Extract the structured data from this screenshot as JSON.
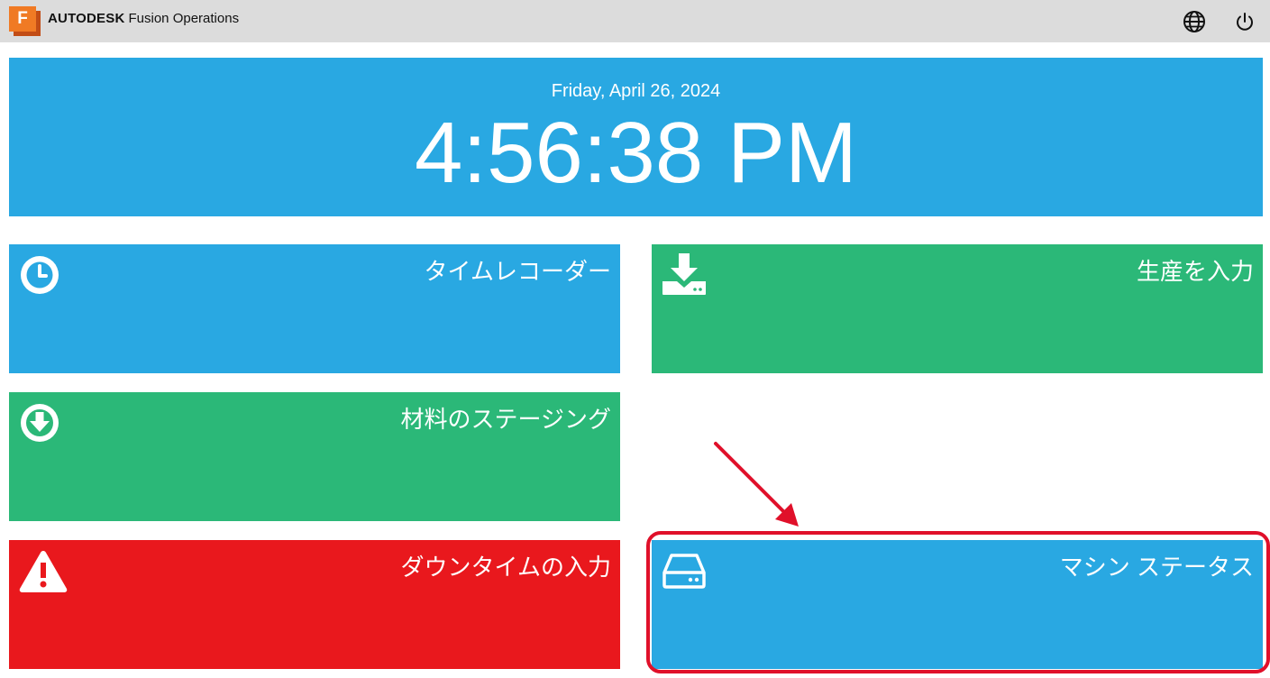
{
  "header": {
    "logo_letter": "F",
    "brand_bold": "AUTODESK",
    "brand_product": "Fusion Operations",
    "icons": [
      "globe-icon",
      "power-icon"
    ]
  },
  "clock": {
    "date": "Friday, April 26, 2024",
    "time": "4:56:38 PM"
  },
  "tiles": {
    "time_recorder": {
      "label": "タイムレコーダー",
      "icon": "clock-icon",
      "color": "#29a8e2"
    },
    "enter_production": {
      "label": "生産を入力",
      "icon": "download-tray-icon",
      "color": "#2bb878"
    },
    "material_staging": {
      "label": "材料のステージング",
      "icon": "download-circle-icon",
      "color": "#2bb878"
    },
    "downtime_entry": {
      "label": "ダウンタイムの入力",
      "icon": "warning-icon",
      "color": "#e9181d"
    },
    "machine_status": {
      "label": "マシン ステータス",
      "icon": "hard-drive-icon",
      "color": "#29a8e2"
    }
  },
  "annotation": {
    "highlight_color": "#e0102a"
  }
}
